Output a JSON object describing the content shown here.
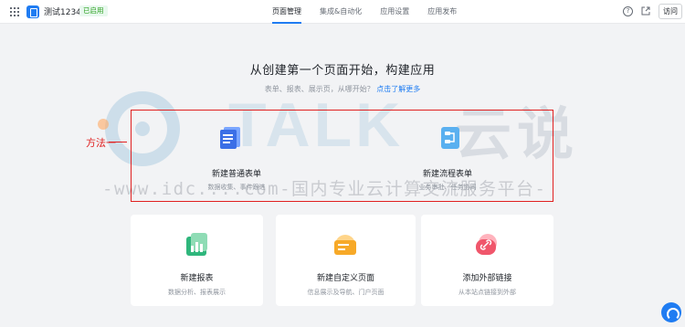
{
  "app": {
    "name": "测试1234",
    "status": "已启用"
  },
  "nav": {
    "tabs": [
      "页面管理",
      "集成&自动化",
      "应用设置",
      "应用发布"
    ]
  },
  "toolbar": {
    "help": "?",
    "visit": "访问"
  },
  "main": {
    "title": "从创建第一个页面开始，构建应用",
    "subtitle": "表单、报表、展示页，从哪开始？",
    "subtitle_link": "点击了解更多"
  },
  "annotation": {
    "label": "方法一"
  },
  "watermark": {
    "big": "TALK",
    "yun": "云说",
    "line": "-www.idc....com-国内专业云计算交流服务平台-"
  },
  "top_cards": [
    {
      "title": "新建普通表单",
      "desc": "数据收集、事件跟进",
      "icon": "form-icon"
    },
    {
      "title": "新建流程表单",
      "desc": "业务审批、任务协同",
      "icon": "flow-form-icon"
    }
  ],
  "cards": [
    {
      "title": "新建报表",
      "desc": "数据分析、报表展示",
      "icon": "report-icon"
    },
    {
      "title": "新建自定义页面",
      "desc": "信息展示及导航、门户页面",
      "icon": "custom-page-icon"
    },
    {
      "title": "添加外部链接",
      "desc": "从本站点链接到外部",
      "icon": "external-link-icon"
    }
  ],
  "colors": {
    "accent": "#1f7cf2",
    "annotation": "#e02020",
    "status": "#2ea121"
  }
}
